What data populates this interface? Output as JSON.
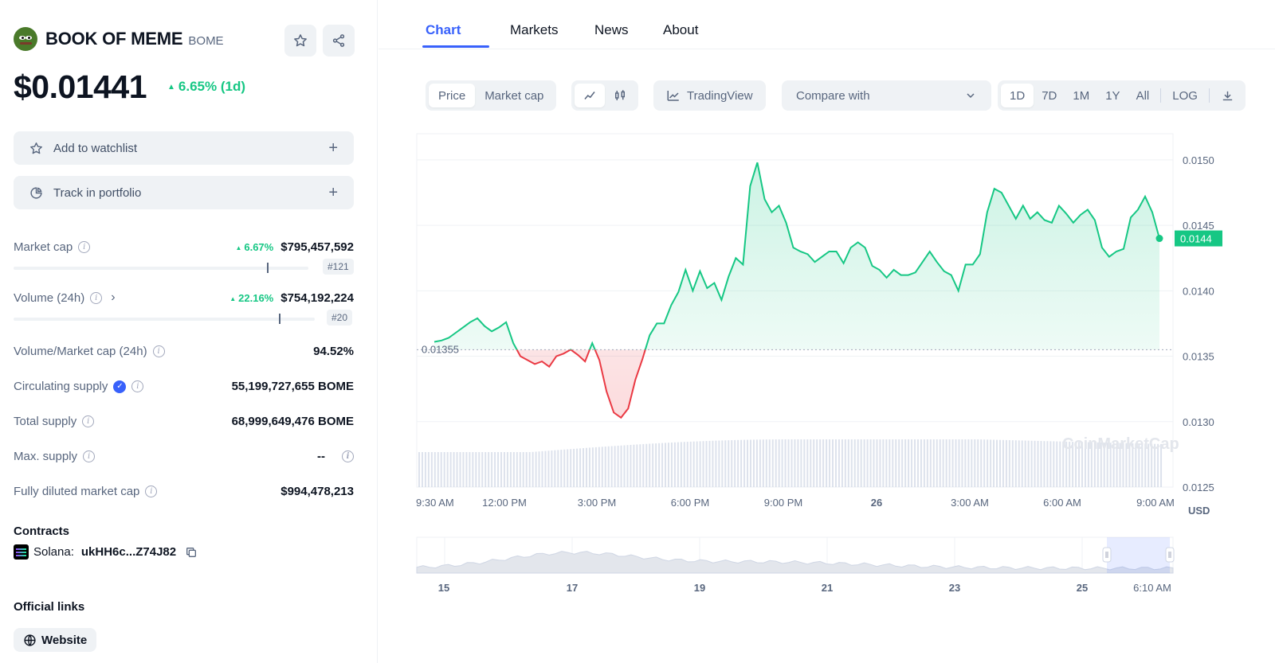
{
  "coin": {
    "name": "BOOK OF MEME",
    "symbol": "BOME",
    "price": "$0.01441",
    "change_1d": "6.65% (1d)"
  },
  "actions": {
    "watchlist": "Add to watchlist",
    "portfolio": "Track in portfolio"
  },
  "stats": {
    "market_cap": {
      "label": "Market cap",
      "pct": "6.67%",
      "value": "$795,457,592",
      "rank": "#121",
      "rank_fraction": 0.86
    },
    "volume": {
      "label": "Volume (24h)",
      "pct": "22.16%",
      "value": "$754,192,224",
      "rank": "#20",
      "rank_fraction": 0.88
    },
    "vol_mcap": {
      "label": "Volume/Market cap (24h)",
      "value": "94.52%"
    },
    "circulating": {
      "label": "Circulating supply",
      "value": "55,199,727,655 BOME"
    },
    "total": {
      "label": "Total supply",
      "value": "68,999,649,476 BOME"
    },
    "max": {
      "label": "Max. supply",
      "value": "--"
    },
    "fdv": {
      "label": "Fully diluted market cap",
      "value": "$994,478,213"
    }
  },
  "contracts": {
    "title": "Contracts",
    "chain": "Solana:",
    "address": "ukHH6c...Z74J82"
  },
  "links": {
    "title": "Official links",
    "website": "Website"
  },
  "tabs": [
    "Chart",
    "Markets",
    "News",
    "About"
  ],
  "toolbar": {
    "price": "Price",
    "market_cap": "Market cap",
    "tradingview": "TradingView",
    "compare": "Compare with",
    "ranges": [
      "1D",
      "7D",
      "1M",
      "1Y",
      "All",
      "LOG"
    ]
  },
  "colors": {
    "up": "#16c784",
    "down": "#ea3943",
    "accent": "#3861fb"
  },
  "chart_data": {
    "type": "line",
    "currency_label": "USD",
    "reference_price": 0.01355,
    "reference_label": "0.01355",
    "current_price_label": "0.0144",
    "ylim": [
      0.0125,
      0.0152
    ],
    "y_ticks": [
      "0.0150",
      "0.0145",
      "0.0140",
      "0.0135",
      "0.0130",
      "0.0125"
    ],
    "x_ticks": [
      "9:30 AM",
      "12:00 PM",
      "3:00 PM",
      "6:00 PM",
      "9:00 PM",
      "26",
      "3:00 AM",
      "6:00 AM",
      "9:00 AM"
    ],
    "x_ticks_bold": [
      "26"
    ],
    "price_series": [
      0.01361,
      0.01362,
      0.01364,
      0.01368,
      0.01372,
      0.01376,
      0.01379,
      0.01373,
      0.01369,
      0.01372,
      0.01376,
      0.0136,
      0.0135,
      0.01347,
      0.01344,
      0.01346,
      0.01342,
      0.0135,
      0.01352,
      0.01355,
      0.01351,
      0.01346,
      0.0136,
      0.01347,
      0.01323,
      0.01307,
      0.01303,
      0.0131,
      0.01332,
      0.01348,
      0.01366,
      0.01375,
      0.01375,
      0.01389,
      0.01399,
      0.01416,
      0.014,
      0.01415,
      0.01402,
      0.01406,
      0.01393,
      0.01411,
      0.01425,
      0.0142,
      0.0148,
      0.01498,
      0.0147,
      0.0146,
      0.01465,
      0.01452,
      0.01433,
      0.0143,
      0.01428,
      0.01422,
      0.01426,
      0.0143,
      0.0143,
      0.01421,
      0.01433,
      0.01437,
      0.01433,
      0.01419,
      0.01416,
      0.0141,
      0.01416,
      0.01412,
      0.01412,
      0.01414,
      0.01422,
      0.0143,
      0.01422,
      0.01415,
      0.01412,
      0.014,
      0.0142,
      0.0142,
      0.01428,
      0.0146,
      0.01478,
      0.01475,
      0.01465,
      0.01455,
      0.01465,
      0.01455,
      0.0146,
      0.01454,
      0.01452,
      0.01465,
      0.01459,
      0.01452,
      0.01458,
      0.01462,
      0.01454,
      0.01433,
      0.01426,
      0.0143,
      0.01432,
      0.01456,
      0.01462,
      0.01472,
      0.0146,
      0.0144
    ],
    "volume_note": "volume bars",
    "watermark": "CoinMarketCap",
    "navigator_ticks": [
      "15",
      "17",
      "19",
      "21",
      "23",
      "25",
      "6:10 AM"
    ]
  }
}
